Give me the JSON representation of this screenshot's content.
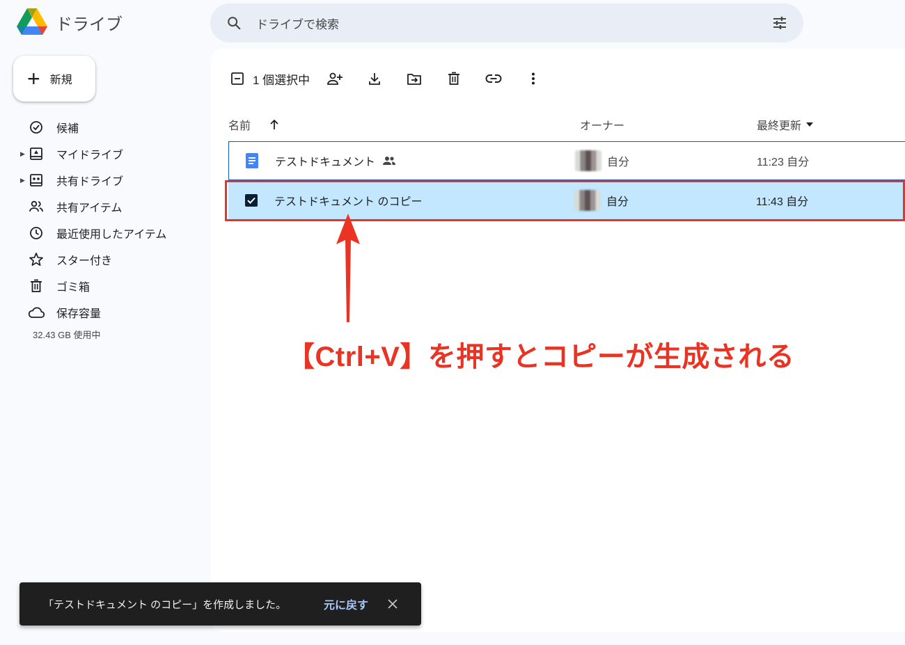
{
  "app": {
    "title": "ドライブ"
  },
  "search": {
    "placeholder": "ドライブで検索"
  },
  "sidebar": {
    "new_label": "新規",
    "items": [
      {
        "label": "候補",
        "icon": "suggested-icon"
      },
      {
        "label": "マイドライブ",
        "icon": "my-drive-icon",
        "expandable": true
      },
      {
        "label": "共有ドライブ",
        "icon": "shared-drive-icon",
        "expandable": true
      },
      {
        "label": "共有アイテム",
        "icon": "people-icon"
      },
      {
        "label": "最近使用したアイテム",
        "icon": "clock-icon"
      },
      {
        "label": "スター付き",
        "icon": "star-icon"
      },
      {
        "label": "ゴミ箱",
        "icon": "trash-icon"
      },
      {
        "label": "保存容量",
        "icon": "cloud-icon"
      }
    ],
    "storage_text": "32.43 GB 使用中"
  },
  "toolbar": {
    "selection_text": "1 個選択中",
    "icons": [
      "deselect-icon",
      "share-icon",
      "download-icon",
      "move-icon",
      "trash-icon",
      "link-icon",
      "more-icon"
    ]
  },
  "table": {
    "headers": {
      "name": "名前",
      "owner": "オーナー",
      "modified": "最終更新"
    },
    "rows": [
      {
        "name": "テストドキュメント",
        "owner": "自分",
        "modified": "11:23 自分",
        "shared": true,
        "selected": false
      },
      {
        "name": "テストドキュメント のコピー",
        "owner": "自分",
        "modified": "11:43 自分",
        "shared": false,
        "selected": true
      }
    ]
  },
  "annotation": {
    "text": "【Ctrl+V】を押すとコピーが生成される",
    "color": "#ea3323"
  },
  "snackbar": {
    "message": "「テストドキュメント のコピー」を作成しました。",
    "undo_label": "元に戻す"
  },
  "colors": {
    "accent": "#0b57d0",
    "selected_row": "#c2e7ff",
    "annotation": "#ea3323"
  }
}
